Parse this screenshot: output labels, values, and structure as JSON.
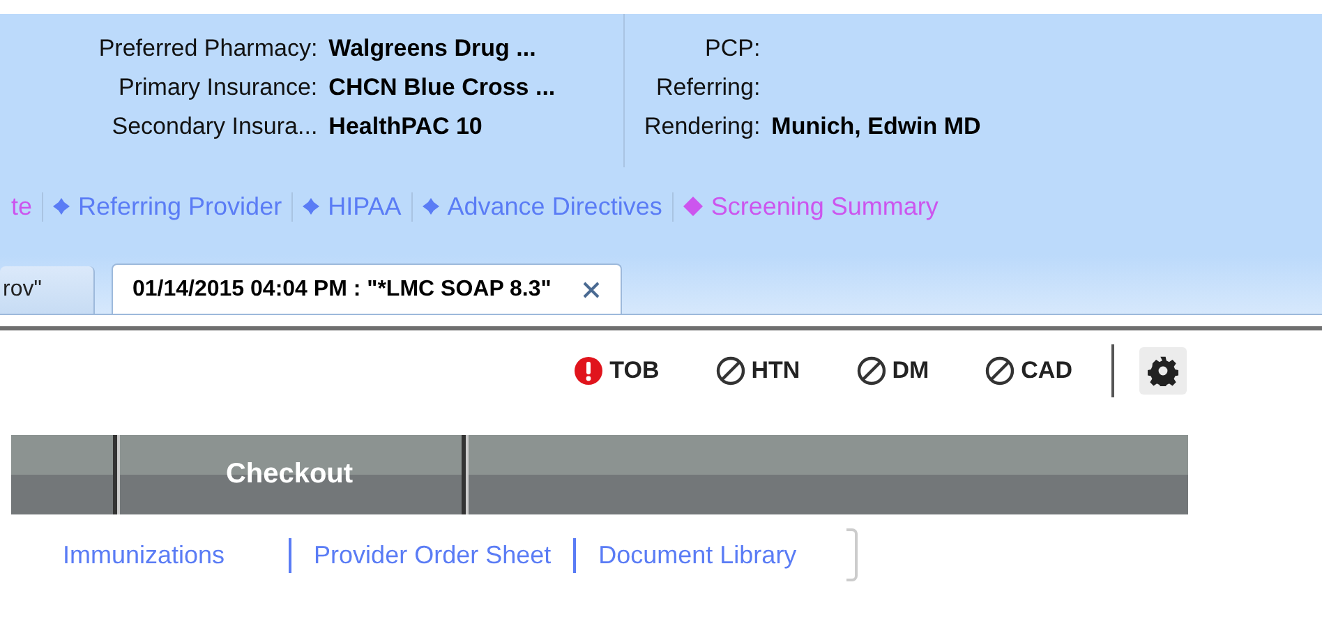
{
  "patient_info": {
    "left": [
      {
        "label": "Preferred Pharmacy:",
        "value": "Walgreens Drug ..."
      },
      {
        "label": "Primary Insurance:",
        "value": "CHCN Blue Cross ..."
      },
      {
        "label": "Secondary Insura...",
        "value": "HealthPAC 10"
      }
    ],
    "right": [
      {
        "label": "PCP:"
      },
      {
        "label": "Referring:"
      },
      {
        "label": "Rendering:",
        "value": "Munich, Edwin MD"
      }
    ]
  },
  "quick_links": [
    {
      "label": "te",
      "color": "#cc55ee",
      "kind": "plain"
    },
    {
      "label": "Referring Provider",
      "color": "#5a7cf5",
      "kind": "bullet"
    },
    {
      "label": "HIPAA",
      "color": "#5a7cf5",
      "kind": "bullet"
    },
    {
      "label": "Advance Directives",
      "color": "#5a7cf5",
      "kind": "bullet"
    },
    {
      "label": "Screening Summary",
      "color": "#cc55ee",
      "kind": "diamond"
    }
  ],
  "tabs": [
    {
      "label": "rov\"",
      "selected": false,
      "closable": false
    },
    {
      "label": "01/14/2015 04:04 PM : \"*LMC SOAP 8.3\"",
      "selected": true,
      "closable": true
    }
  ],
  "alerts": [
    {
      "label": "TOB",
      "kind": "alert"
    },
    {
      "label": "HTN",
      "kind": "none"
    },
    {
      "label": "DM",
      "kind": "none"
    },
    {
      "label": "CAD",
      "kind": "none"
    }
  ],
  "nav_bar": {
    "items": [
      {
        "kind": "blank"
      },
      {
        "kind": "tab",
        "label": "Checkout"
      },
      {
        "kind": "blank"
      }
    ]
  },
  "bottom_links": [
    "Immunizations",
    "Provider Order Sheet",
    "Document Library"
  ]
}
